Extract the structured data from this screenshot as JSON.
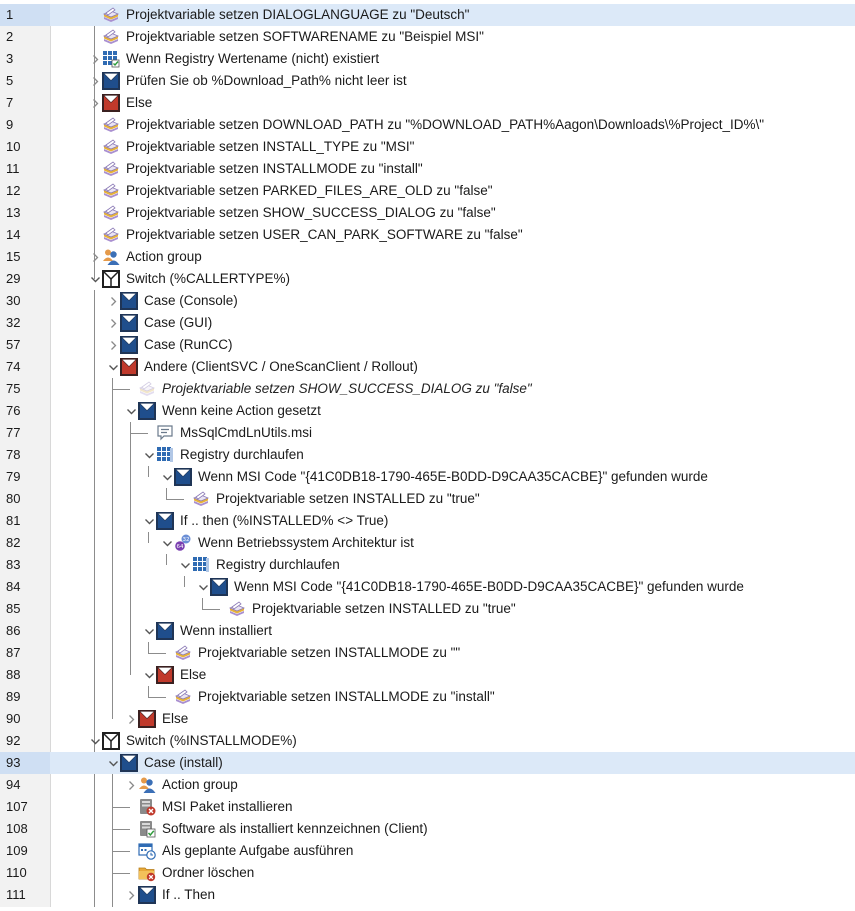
{
  "rows": [
    {
      "n": "1",
      "t": "Projektvariable setzen DIALOGLANGUAGE zu \"Deutsch\"",
      "icon": "set-variable-icon",
      "d": 0,
      "tw": "",
      "sel": true
    },
    {
      "n": "2",
      "t": "Projektvariable setzen SOFTWARENAME zu \"Beispiel MSI\"",
      "icon": "set-variable-icon",
      "d": 0,
      "tw": ""
    },
    {
      "n": "3",
      "t": "Wenn Registry Wertename (nicht) existiert",
      "icon": "registry-grid-icon",
      "d": 0,
      "tw": "r"
    },
    {
      "n": "5",
      "t": "Prüfen Sie ob %Download_Path% nicht leer ist",
      "icon": "condition-blue-icon",
      "d": 0,
      "tw": "r"
    },
    {
      "n": "7",
      "t": "Else",
      "icon": "condition-red-icon",
      "d": 0,
      "tw": "r"
    },
    {
      "n": "9",
      "t": "Projektvariable setzen DOWNLOAD_PATH zu \"%DOWNLOAD_PATH%Aagon\\Downloads\\%Project_ID%\\\"",
      "icon": "set-variable-icon",
      "d": 0,
      "tw": ""
    },
    {
      "n": "10",
      "t": "Projektvariable setzen INSTALL_TYPE zu \"MSI\"",
      "icon": "set-variable-icon",
      "d": 0,
      "tw": ""
    },
    {
      "n": "11",
      "t": "Projektvariable setzen INSTALLMODE zu \"install\"",
      "icon": "set-variable-icon",
      "d": 0,
      "tw": ""
    },
    {
      "n": "12",
      "t": "Projektvariable setzen PARKED_FILES_ARE_OLD zu \"false\"",
      "icon": "set-variable-icon",
      "d": 0,
      "tw": ""
    },
    {
      "n": "13",
      "t": "Projektvariable setzen SHOW_SUCCESS_DIALOG zu \"false\"",
      "icon": "set-variable-icon",
      "d": 0,
      "tw": ""
    },
    {
      "n": "14",
      "t": "Projektvariable setzen USER_CAN_PARK_SOFTWARE zu \"false\"",
      "icon": "set-variable-icon",
      "d": 0,
      "tw": ""
    },
    {
      "n": "15",
      "t": "Action group",
      "icon": "action-group-icon",
      "d": 0,
      "tw": "r"
    },
    {
      "n": "29",
      "t": "Switch (%CALLERTYPE%)",
      "icon": "switch-icon",
      "d": 0,
      "tw": "d"
    },
    {
      "n": "30",
      "t": "Case (Console)",
      "icon": "condition-blue-icon",
      "d": 1,
      "tw": "r"
    },
    {
      "n": "32",
      "t": "Case (GUI)",
      "icon": "condition-blue-icon",
      "d": 1,
      "tw": "r"
    },
    {
      "n": "57",
      "t": "Case (RunCC)",
      "icon": "condition-blue-icon",
      "d": 1,
      "tw": "r"
    },
    {
      "n": "74",
      "t": "Andere (ClientSVC / OneScanClient / Rollout)",
      "icon": "condition-red-icon",
      "d": 1,
      "tw": "d"
    },
    {
      "n": "75",
      "t": "Projektvariable setzen SHOW_SUCCESS_DIALOG zu \"false\"",
      "icon": "set-variable-disabled-icon",
      "d": 2,
      "tw": "",
      "it": true
    },
    {
      "n": "76",
      "t": "Wenn keine Action gesetzt",
      "icon": "condition-blue-icon",
      "d": 2,
      "tw": "d"
    },
    {
      "n": "77",
      "t": "MsSqlCmdLnUtils.msi",
      "icon": "comment-icon",
      "d": 3,
      "tw": ""
    },
    {
      "n": "78",
      "t": "Registry durchlaufen",
      "icon": "registry-loop-icon",
      "d": 3,
      "tw": "d"
    },
    {
      "n": "79",
      "t": "Wenn MSI Code \"{41C0DB18-1790-465E-B0DD-D9CAA35CACBE}\" gefunden wurde",
      "icon": "condition-blue-icon",
      "d": 4,
      "tw": "d"
    },
    {
      "n": "80",
      "t": "Projektvariable setzen INSTALLED zu \"true\"",
      "icon": "set-variable-icon",
      "d": 5,
      "tw": ""
    },
    {
      "n": "81",
      "t": "If .. then (%INSTALLED% <> True)",
      "icon": "condition-blue-icon",
      "d": 3,
      "tw": "d"
    },
    {
      "n": "82",
      "t": "Wenn Betriebssystem Architektur ist",
      "icon": "os-arch-icon",
      "d": 4,
      "tw": "d"
    },
    {
      "n": "83",
      "t": "Registry durchlaufen",
      "icon": "registry-loop-icon",
      "d": 5,
      "tw": "d"
    },
    {
      "n": "84",
      "t": "Wenn MSI Code \"{41C0DB18-1790-465E-B0DD-D9CAA35CACBE}\" gefunden wurde",
      "icon": "condition-blue-icon",
      "d": 6,
      "tw": "d"
    },
    {
      "n": "85",
      "t": "Projektvariable setzen INSTALLED zu \"true\"",
      "icon": "set-variable-icon",
      "d": 7,
      "tw": ""
    },
    {
      "n": "86",
      "t": "Wenn installiert",
      "icon": "condition-blue-icon",
      "d": 3,
      "tw": "d"
    },
    {
      "n": "87",
      "t": "Projektvariable setzen INSTALLMODE zu \"\"",
      "icon": "set-variable-icon",
      "d": 4,
      "tw": ""
    },
    {
      "n": "88",
      "t": "Else",
      "icon": "condition-red-icon",
      "d": 3,
      "tw": "d"
    },
    {
      "n": "89",
      "t": "Projektvariable setzen INSTALLMODE zu \"install\"",
      "icon": "set-variable-icon",
      "d": 4,
      "tw": ""
    },
    {
      "n": "90",
      "t": "Else",
      "icon": "condition-red-icon",
      "d": 2,
      "tw": "r"
    },
    {
      "n": "92",
      "t": "Switch (%INSTALLMODE%)",
      "icon": "switch-icon",
      "d": 0,
      "tw": "d"
    },
    {
      "n": "93",
      "t": "Case (install)",
      "icon": "condition-blue-icon",
      "d": 1,
      "tw": "d",
      "sel": true
    },
    {
      "n": "94",
      "t": "Action group",
      "icon": "action-group-icon",
      "d": 2,
      "tw": "r"
    },
    {
      "n": "107",
      "t": "MSI Paket installieren",
      "icon": "msi-install-icon",
      "d": 2,
      "tw": ""
    },
    {
      "n": "108",
      "t": "Software als installiert kennzeichnen (Client)",
      "icon": "mark-installed-icon",
      "d": 2,
      "tw": ""
    },
    {
      "n": "109",
      "t": "Als geplante Aufgabe ausführen",
      "icon": "scheduled-task-icon",
      "d": 2,
      "tw": ""
    },
    {
      "n": "110",
      "t": "Ordner löschen",
      "icon": "delete-folder-icon",
      "d": 2,
      "tw": ""
    },
    {
      "n": "111",
      "t": "If .. Then",
      "icon": "condition-blue-icon",
      "d": 2,
      "tw": "r"
    }
  ],
  "os_badges": [
    "32",
    "64"
  ],
  "colors": {
    "selection": "#dce9f8",
    "condition_blue": "#1f4e8c",
    "condition_red": "#c0392b",
    "action_group": "#3b6fb6",
    "gutter": "#f2f2f2"
  }
}
